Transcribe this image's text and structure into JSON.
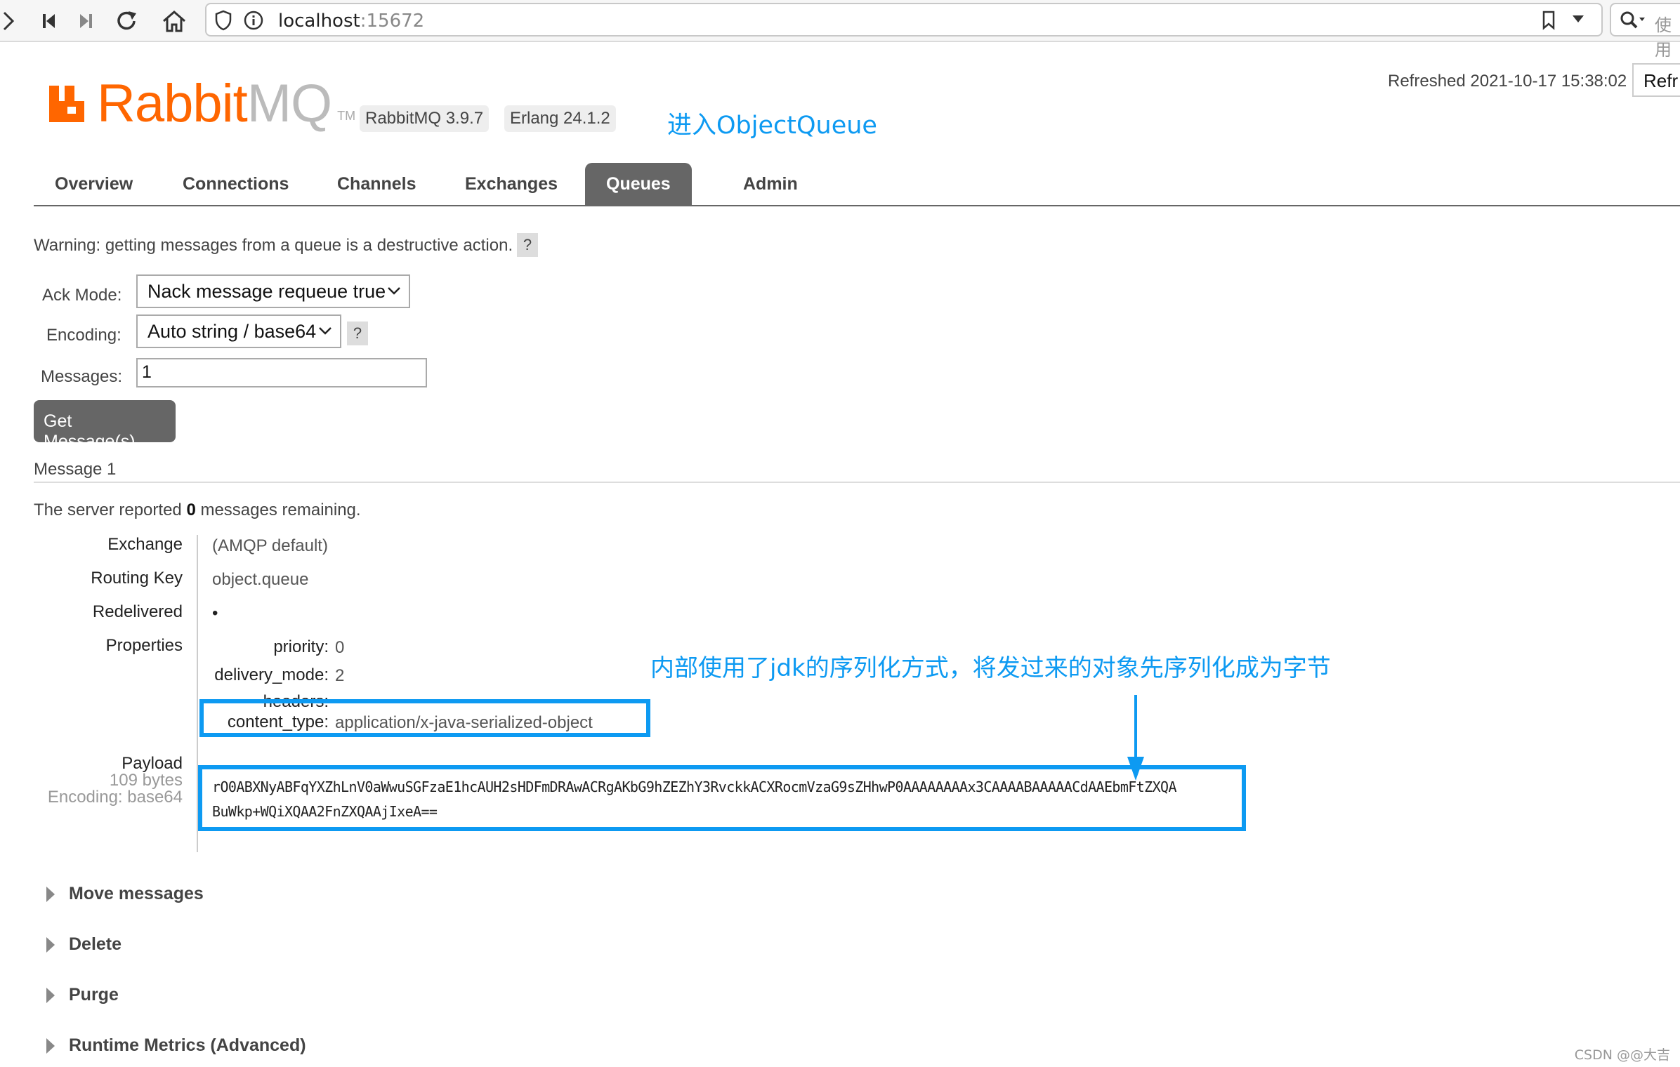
{
  "browser": {
    "url_host": "localhost",
    "url_port": ":15672",
    "search_placeholder": "使用"
  },
  "header": {
    "logo_rabbit": "Rabbit",
    "logo_mq": "MQ",
    "logo_tm": "TM",
    "version": "RabbitMQ 3.9.7",
    "erlang": "Erlang 24.1.2",
    "refreshed": "Refreshed 2021-10-17 15:38:02",
    "refresh_button": "Refr"
  },
  "annotations": {
    "enter_queue": "进入ObjectQueue",
    "serialization_note": "内部使用了jdk的序列化方式，将发过来的对象先序列化成为字节"
  },
  "tabs": [
    "Overview",
    "Connections",
    "Channels",
    "Exchanges",
    "Queues",
    "Admin"
  ],
  "active_tab": "Queues",
  "get_messages": {
    "warning": "Warning: getting messages from a queue is a destructive action.",
    "help": "?",
    "ack_mode_label": "Ack Mode:",
    "ack_mode_value": "Nack message requeue true",
    "encoding_label": "Encoding:",
    "encoding_value": "Auto string / base64",
    "messages_label": "Messages:",
    "messages_value": "1",
    "button": "Get Message(s)"
  },
  "message": {
    "heading": "Message 1",
    "remaining_prefix": "The server reported ",
    "remaining_count": "0",
    "remaining_suffix": " messages remaining.",
    "exchange_label": "Exchange",
    "exchange_value": "(AMQP default)",
    "routing_key_label": "Routing Key",
    "routing_key_value": "object.queue",
    "redelivered_label": "Redelivered",
    "redelivered_value": "•",
    "properties_label": "Properties",
    "properties": {
      "priority_label": "priority:",
      "priority_value": "0",
      "delivery_mode_label": "delivery_mode:",
      "delivery_mode_value": "2",
      "headers_label": "headers:",
      "content_type_label": "content_type:",
      "content_type_value": "application/x-java-serialized-object"
    },
    "payload_label": "Payload",
    "payload_size": "109 bytes",
    "payload_encoding": "Encoding: base64",
    "payload_line1": "rO0ABXNyABFqYXZhLnV0aWwuSGFzaE1hcAUH2sHDFmDRAwACRgAKbG9hZEZhY3RvckkACXRocmVzaG9sZHhwP0AAAAAAAAx3CAAAABAAAAACdAAEbmFtZXQA",
    "payload_line2": "BuWkp+WQiXQAA2FnZXQAAjIxeA=="
  },
  "sections": [
    "Move messages",
    "Delete",
    "Purge",
    "Runtime Metrics (Advanced)"
  ],
  "watermark": "CSDN @@大吉"
}
